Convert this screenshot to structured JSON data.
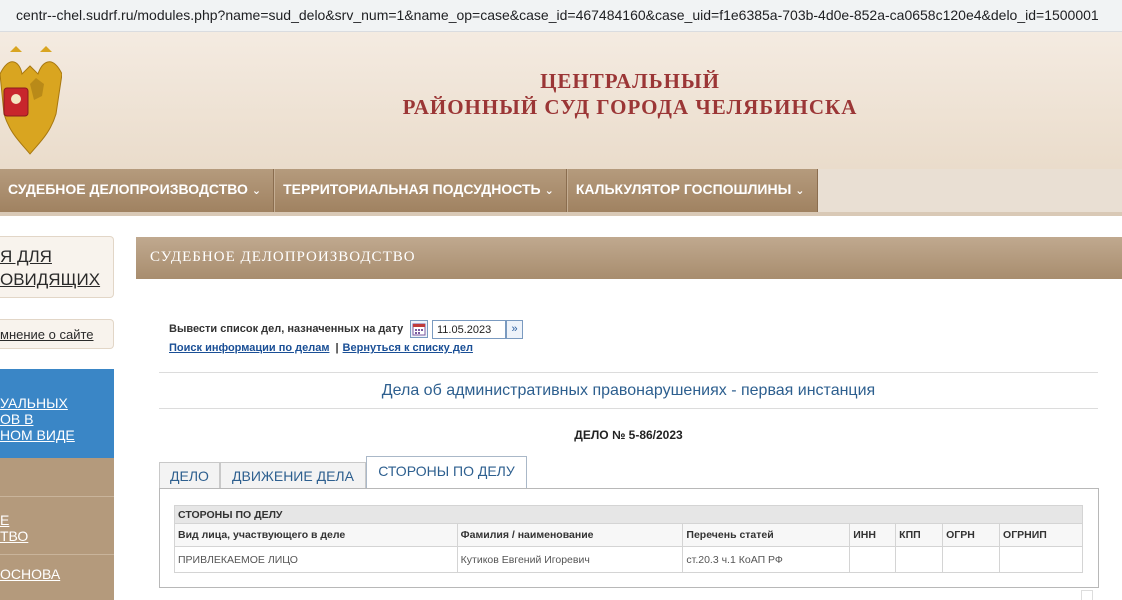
{
  "browser": {
    "url": "centr--chel.sudrf.ru/modules.php?name=sud_delo&srv_num=1&name_op=case&case_id=467484160&case_uid=f1e6385a-703b-4d0e-852a-ca0658c120e4&delo_id=1500001"
  },
  "header": {
    "title_line1": "ЦЕНТРАЛЬНЫЙ",
    "title_line2": "РАЙОННЫЙ СУД ГОРОДА ЧЕЛЯБИНСКА"
  },
  "topnav": {
    "items": [
      {
        "label": "СУДЕБНОЕ ДЕЛОПРОИЗВОДСТВО",
        "chevron": "⌄"
      },
      {
        "label": "ТЕРРИТОРИАЛЬНАЯ ПОДСУДНОСТЬ",
        "chevron": "⌄"
      },
      {
        "label": "КАЛЬКУЛЯТОР ГОСПОШЛИНЫ",
        "chevron": "⌄"
      }
    ]
  },
  "sidebar": {
    "box1_label": "Я ДЛЯ\nОВИДЯЩИХ",
    "box2_label": "мнение о сайте",
    "blue_label": "УАЛЬНЫХ\nОВ В\nНОМ ВИДЕ",
    "brown_items": [
      "Е\nТВО",
      "ОСНОВА"
    ]
  },
  "panel": {
    "title": "СУДЕБНОЕ ДЕЛОПРОИЗВОДСТВО",
    "date_label": "Вывести список дел, назначенных на дату",
    "date_value": "11.05.2023",
    "go_icon": "»",
    "link_search": "Поиск информации по делам",
    "link_separator": "|",
    "link_back": "Вернуться к списку дел",
    "section_title": "Дела об административных правонарушениях - первая инстанция",
    "case_number": "ДЕЛО № 5-86/2023"
  },
  "tabs": [
    {
      "label": "ДЕЛО",
      "active": false
    },
    {
      "label": "ДВИЖЕНИЕ ДЕЛА",
      "active": false
    },
    {
      "label": "СТОРОНЫ ПО ДЕЛУ",
      "active": true
    }
  ],
  "parties_table": {
    "caption": "СТОРОНЫ ПО ДЕЛУ",
    "headers": [
      "Вид лица, участвующего в деле",
      "Фамилия / наименование",
      "Перечень статей",
      "ИНН",
      "КПП",
      "ОГРН",
      "ОГРНИП"
    ],
    "rows": [
      [
        "ПРИВЛЕКАЕМОЕ ЛИЦО",
        "Кутиков Евгений Игоревич",
        "ст.20.3 ч.1 КоАП РФ",
        "",
        "",
        "",
        ""
      ]
    ]
  },
  "colors": {
    "court_title": "#9b3636",
    "nav_brown": "#a08261",
    "sidebar_blue": "#3a86c6",
    "link_blue": "#1a4f96",
    "section_title": "#2d5f8f"
  }
}
